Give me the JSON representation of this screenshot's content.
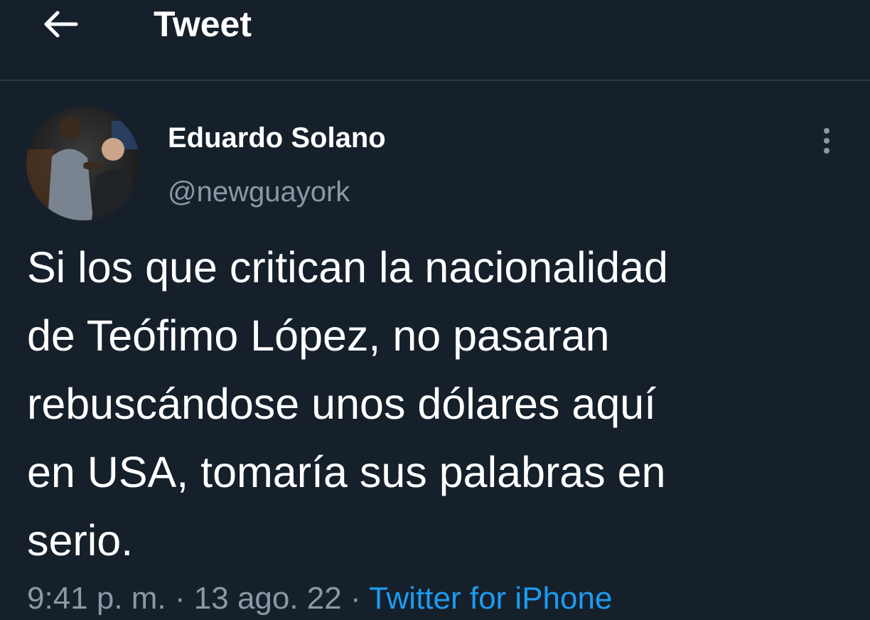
{
  "header": {
    "title": "Tweet",
    "back_icon": "arrow-left-icon"
  },
  "author": {
    "name": "Eduardo Solano",
    "handle": "@newguayork",
    "avatar_icon": "profile-photo"
  },
  "menu": {
    "icon": "more-vertical-icon"
  },
  "tweet": {
    "text": "Si los que critican la nacionalidad\nde Teófimo López, no pasaran\nrebuscándose unos dólares aquí\nen USA, tomaría sus palabras en\nserio."
  },
  "meta": {
    "time": "9:41 p. m.",
    "separator": " · ",
    "date": "13 ago. 22",
    "source": "Twitter for iPhone"
  },
  "colors": {
    "background": "#15202b",
    "text_primary": "#ffffff",
    "text_secondary": "#8b98a5",
    "accent": "#1d9bf0"
  }
}
